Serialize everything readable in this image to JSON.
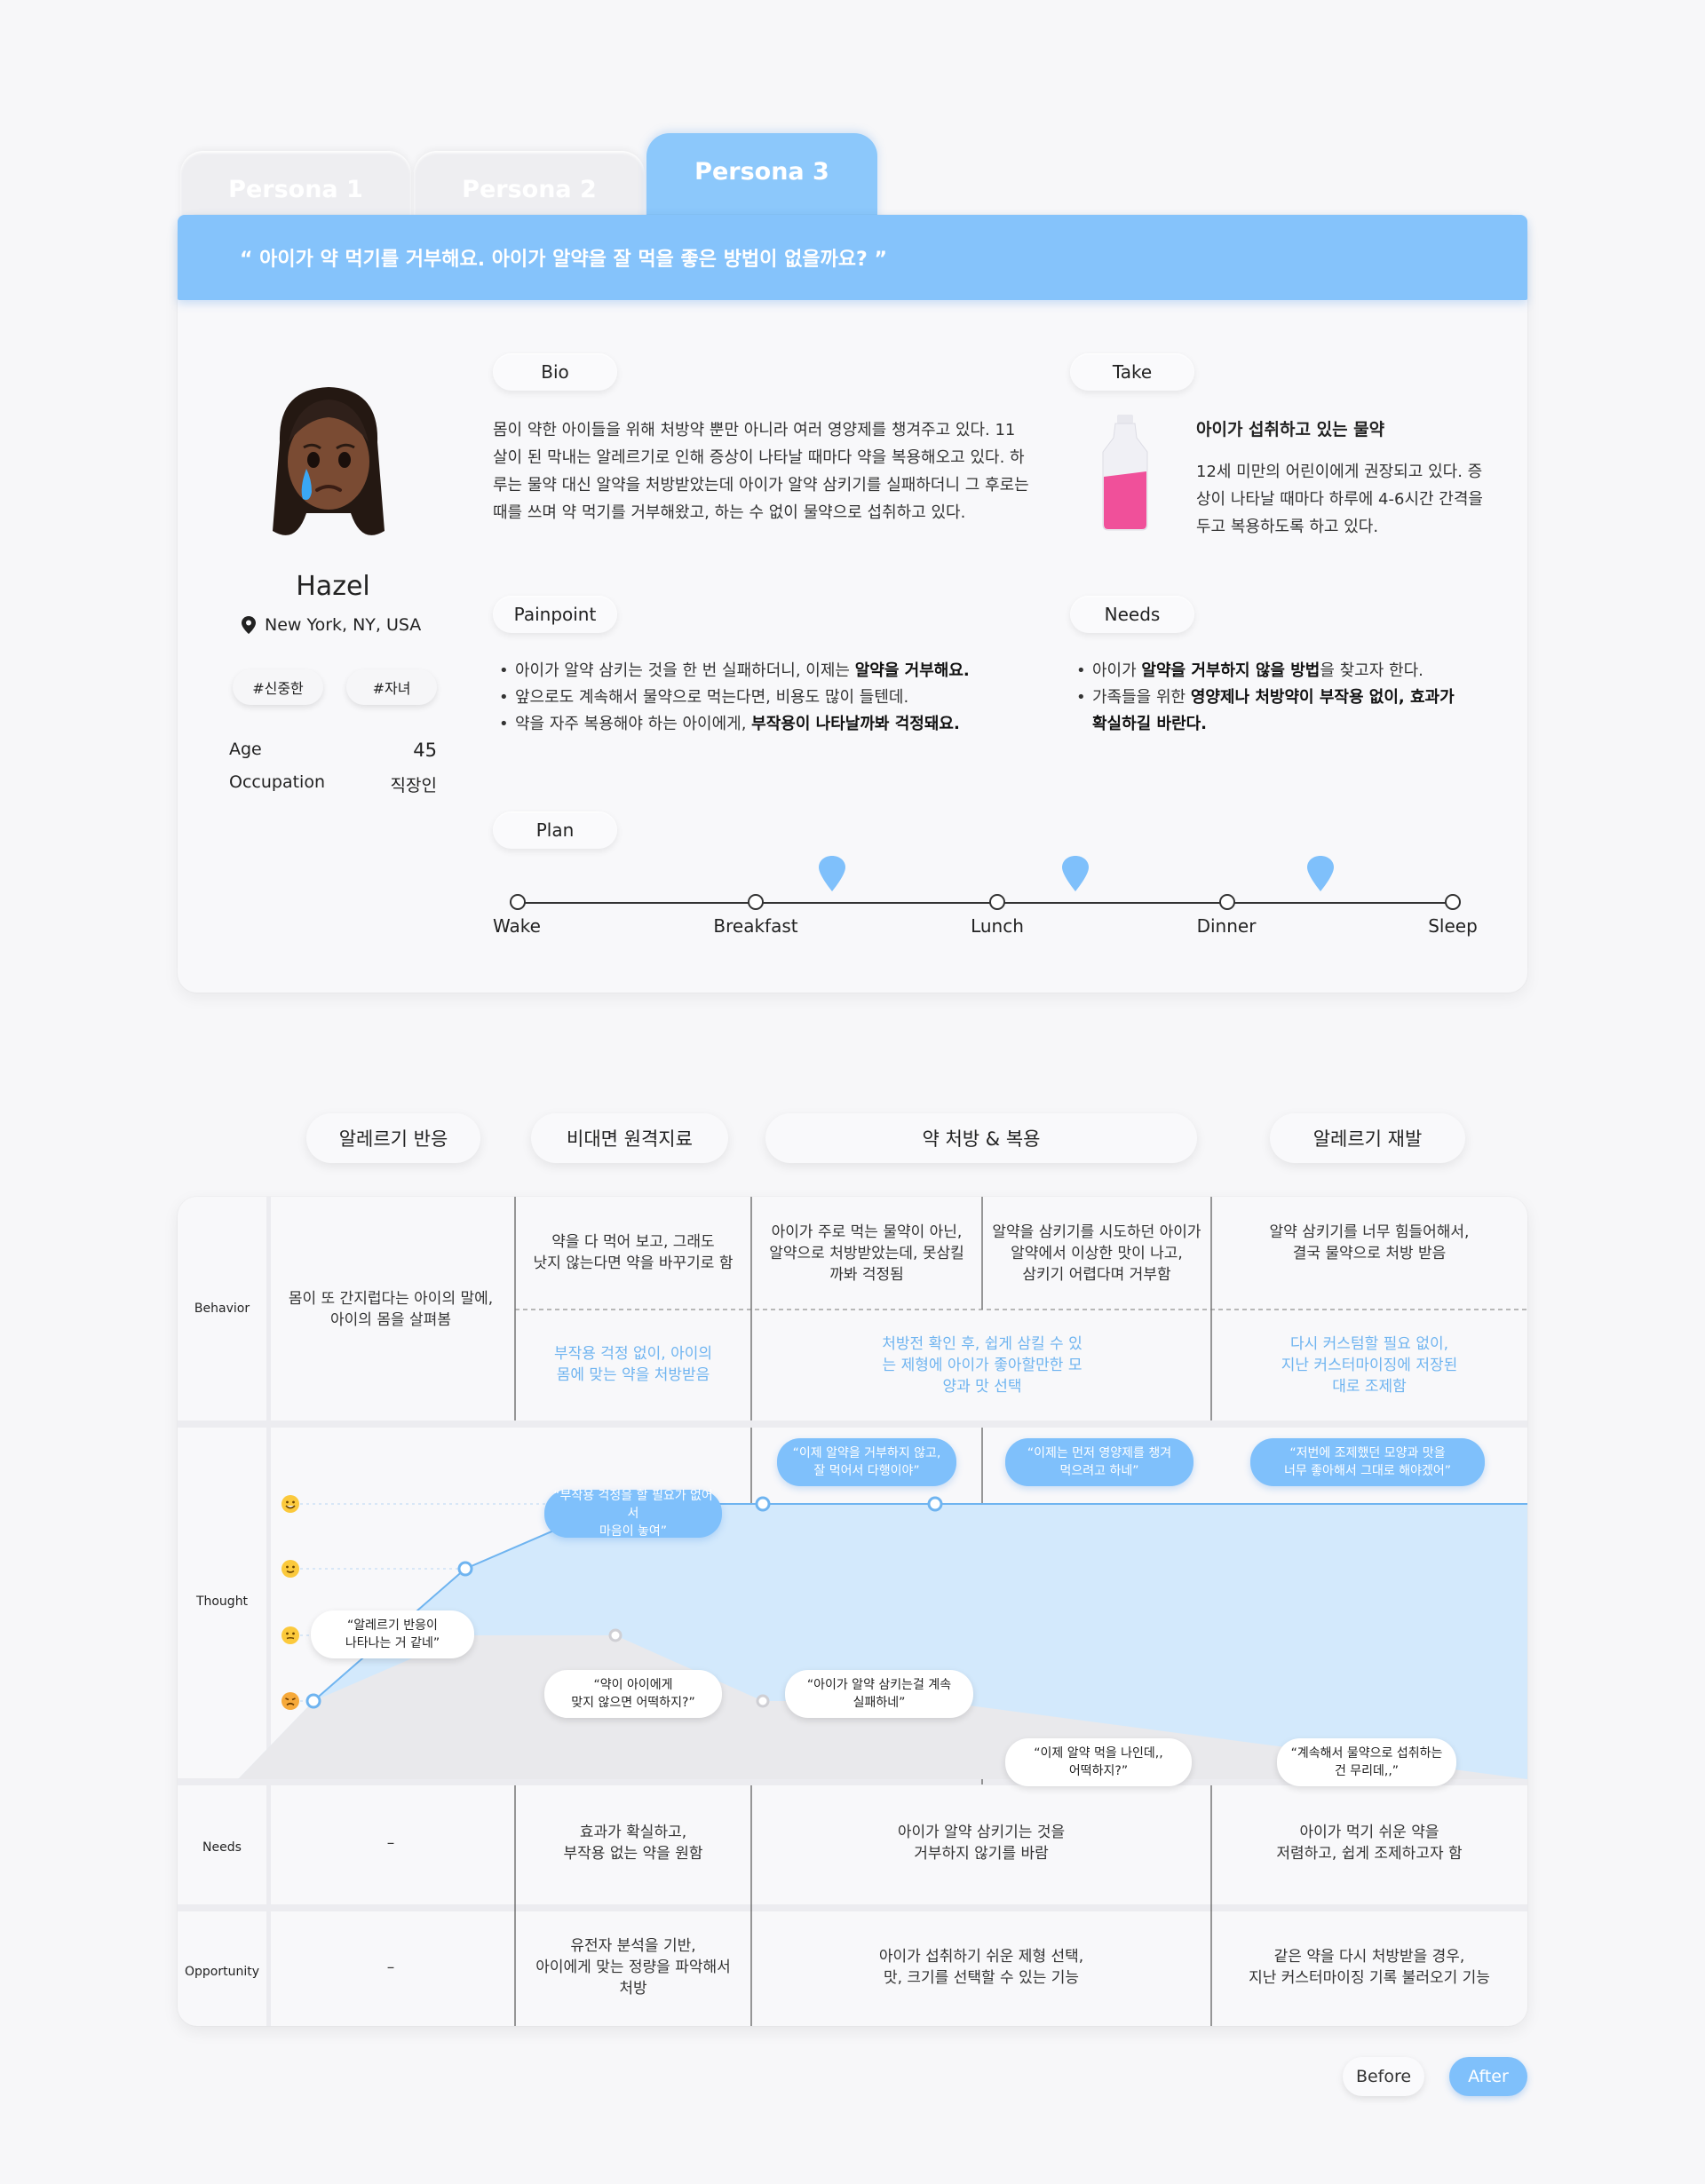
{
  "tabs": [
    {
      "label": "Persona 1",
      "active": false
    },
    {
      "label": "Persona 2",
      "active": false
    },
    {
      "label": "Persona 3",
      "active": true
    }
  ],
  "persona": {
    "quote": "“ 아이가 약 먹기를 거부해요. 아이가 알약을 잘 먹을 좋은 방법이 없을까요? ”",
    "name": "Hazel",
    "location": "New York, NY, USA",
    "tags": [
      "#신중한",
      "#자녀"
    ],
    "age_label": "Age",
    "age": "45",
    "occupation_label": "Occupation",
    "occupation": "직장인",
    "bio_title": "Bio",
    "bio": "몸이 약한 아이들을 위해 처방약 뿐만 아니라 여러 영양제를 챙겨주고 있다. 11 살이 된 막내는 알레르기로 인해 증상이 나타날 때마다 약을 복용해오고 있다. 하루는 물약 대신 알약을 처방받았는데 아이가 알약 삼키기를 실패하더니 그 후로는 때를 쓰며 약 먹기를 거부해왔고, 하는 수 없이 물약으로 섭취하고 있다.",
    "take_title": "Take",
    "take_heading": "아이가 섭취하고 있는 물약",
    "take_text": "12세 미만의 어린이에게 권장되고 있다. 증상이 나타날 때마다 하루에 4-6시간 간격을 두고 복용하도록 하고 있다.",
    "painpoint_title": "Painpoint",
    "painpoints": [
      {
        "text": "아이가 알약 삼키는 것을 한 번 실패하더니, 이제는 ",
        "bold": "알약을 거부해요."
      },
      {
        "text": "앞으로도 계속해서 물약으로 먹는다면, 비용도 많이 들텐데.",
        "bold": ""
      },
      {
        "text": "약을 자주 복용해야 하는 아이에게, ",
        "bold": "부작용이 나타날까봐 걱정돼요."
      }
    ],
    "needs_title": "Needs",
    "needs": [
      {
        "pre": "아이가 ",
        "bold": "알약을 거부하지 않을 방법",
        "post": "을 찾고자 한다."
      },
      {
        "pre": "가족들을 위한 ",
        "bold": "영양제나 처방약이 부작용 없이, 효과가 확실하길 바란다.",
        "post": ""
      }
    ],
    "plan_title": "Plan",
    "plan": [
      "Wake",
      "Breakfast",
      "Lunch",
      "Dinner",
      "Sleep"
    ]
  },
  "stages": [
    "알레르기 반응",
    "비대면 원격지료",
    "약 처방 & 복용",
    "알레르기 재발"
  ],
  "journey": {
    "row_labels": [
      "Behavior",
      "Thought",
      "Needs",
      "Opportunity"
    ],
    "behavior": [
      "몸이 또 간지럽다는 아이의 말에,\n아이의 몸을 살펴봄",
      "약을 다 먹어 보고, 그래도\n낫지 않는다면 약을 바꾸기로 함",
      "아이가 주로 먹는 물약이 아닌,\n알약으로 처방받았는데, 못삼킬\n까봐 걱정됨",
      "알약을 삼키기를 시도하던 아이가\n알약에서 이상한 맛이 나고,\n삼키기 어렵다며 거부함",
      "알약 삼키기를 너무 힘들어해서,\n결국 물약으로 처방 받음"
    ],
    "behavior_after": [
      "부작용 걱정 없이, 아이의\n몸에 맞는 약을 처방받음",
      "처방전 확인 후, 쉽게 삼킬 수 있\n는 제형에 아이가 좋아할만한 모\n양과 맛 선택",
      "다시 커스텀할 필요 없이,\n지난 커스터마이징에 저장된\n대로 조제함"
    ],
    "thought_before": [
      "“알레르기 반응이\n나타나는 거 같네”",
      "“약이 아이에게\n맞지 않으면 어떡하지?”",
      "“아이가 알약 삼키는걸 계속\n실패하네”",
      "“이제 알약 먹을 나인데,,\n어떡하지?”",
      "“계속해서 물약으로 섭취하는\n건 무리데,,”"
    ],
    "thought_after": [
      "“부작용 걱정을 할 필요가 없어서\n마음이 놓여”",
      "“이제 알약을 거부하지 않고,\n잘 먹어서 다행이야”",
      "“이제는 먼저 영양제를 챙겨\n먹으려고 하네”",
      "“저번에 조제했던 모양과 맛을\n너무 좋아해서 그대로 해야겠어”"
    ],
    "emotion_scale": [
      "very-happy-emoji",
      "happy-emoji",
      "neutral-emoji",
      "unhappy-emoji"
    ],
    "emotion_before": [
      1,
      2,
      2,
      1,
      1
    ],
    "emotion_after": [
      1,
      3,
      4,
      4,
      4
    ],
    "needs": [
      "–",
      "효과가 확실하고,\n부작용 없는 약을 원함",
      "아이가 알약 삼키기는 것을\n거부하지 않기를 바람",
      "아이가 먹기 쉬운 약을\n저렴하고, 쉽게 조제하고자 함"
    ],
    "opportunity": [
      "–",
      "유전자 분석을 기반,\n아이에게 맞는 정량을 파악해서\n처방",
      "아이가 섭취하기 쉬운 제형 선택,\n맛, 크기를 선택할 수 있는 기능",
      "같은 약을 다시 처방받을 경우,\n지난 커스터마이징 기록 불러오기 기능"
    ]
  },
  "toggle": {
    "before": "Before",
    "after": "After",
    "selected": "After"
  },
  "colors": {
    "accent": "#85c3fb",
    "accent_dark": "#6fb4f0",
    "after_fill": "#d3e9fc",
    "before_fill": "#e9e9ec",
    "medicine": "#f0509a"
  }
}
